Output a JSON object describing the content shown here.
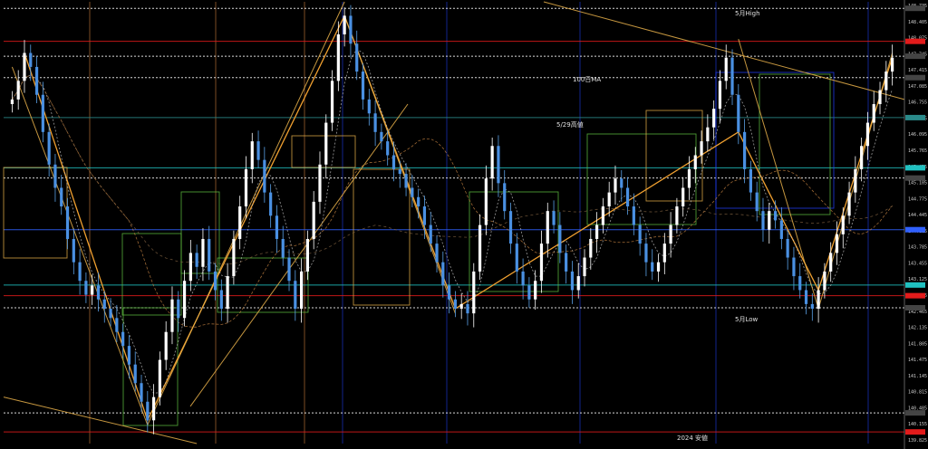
{
  "chart_data": {
    "type": "candlestick",
    "title": "",
    "xlabel": "",
    "ylabel": "",
    "ylim": [
      139.5,
      149.0
    ],
    "grid": false,
    "y_ticks": [
      "148.735",
      "148.405",
      "148.075",
      "147.745",
      "147.415",
      "147.085",
      "146.755",
      "146.425",
      "146.095",
      "145.765",
      "145.435",
      "145.105",
      "144.775",
      "144.445",
      "144.115",
      "143.785",
      "143.455",
      "143.125",
      "142.795",
      "142.465",
      "142.135",
      "141.805",
      "141.475",
      "141.145",
      "140.815",
      "140.485",
      "140.155",
      "139.825"
    ],
    "series": [
      {
        "values": [
          146.9,
          147.3,
          147.9,
          147.6,
          147.0,
          146.2,
          145.5,
          145.0,
          144.6,
          143.9,
          143.4,
          143.0,
          142.7,
          142.9,
          142.6,
          142.4,
          142.2,
          141.9,
          141.6,
          141.2,
          140.8,
          140.4,
          140.0,
          140.5,
          141.3,
          141.9,
          142.6,
          142.2,
          143.0,
          143.6,
          143.3,
          143.9,
          143.2,
          142.8,
          142.4,
          143.1,
          143.9,
          144.6,
          145.4,
          146.0,
          145.6,
          144.9,
          144.4,
          143.9,
          143.5,
          143.0,
          142.4,
          143.2,
          143.9,
          144.7,
          145.5,
          146.4,
          147.3,
          148.3,
          148.7,
          148.1,
          147.5,
          146.9,
          146.6,
          146.2,
          146.0,
          145.7,
          145.4,
          145.3,
          145.0,
          144.8,
          144.6,
          144.2,
          143.8,
          143.4,
          142.9,
          142.6,
          142.4,
          142.5,
          142.3,
          143.2,
          144.2,
          145.2,
          145.9,
          145.1,
          144.5,
          143.8,
          143.2,
          142.9,
          142.6,
          143.0,
          143.8,
          144.5,
          144.2,
          143.6,
          143.2,
          142.8,
          143.1,
          143.5,
          143.9,
          144.2,
          144.6,
          144.9,
          145.2,
          145.0,
          144.6,
          144.2,
          143.8,
          143.4,
          143.2,
          143.4,
          143.8,
          144.2,
          144.6,
          145.0,
          145.4,
          145.7,
          146.0,
          146.3,
          146.7,
          147.3,
          147.8,
          147.0,
          146.2,
          145.4,
          144.9,
          144.5,
          144.1,
          144.5,
          144.3,
          143.9,
          143.5,
          143.1,
          142.8,
          142.5,
          142.4,
          142.8,
          143.2,
          143.6,
          144.0,
          144.4,
          144.9,
          145.4,
          145.9,
          146.4,
          146.8,
          147.1,
          147.5,
          147.8
        ]
      }
    ],
    "horizontal_levels": [
      {
        "label": "5月High",
        "value": 148.86,
        "color": "#ffffff"
      },
      {
        "label": "",
        "value": 148.15,
        "color": "#e21b1b"
      },
      {
        "label": "",
        "value": 147.83,
        "color": "#ffffff"
      },
      {
        "label": "",
        "value": 147.37,
        "color": "#ffffff"
      },
      {
        "label": "5/29高値",
        "value": 146.51,
        "color": "#2a8a8a"
      },
      {
        "label": "",
        "value": 145.43,
        "color": "#20c0c0"
      },
      {
        "label": "",
        "value": 145.21,
        "color": "#ffffff"
      },
      {
        "label": "",
        "value": 144.1,
        "color": "#3060ff"
      },
      {
        "label": "",
        "value": 142.91,
        "color": "#20c0c0"
      },
      {
        "label": "",
        "value": 142.68,
        "color": "#e21b1b"
      },
      {
        "label": "5月Low",
        "value": 142.42,
        "color": "#ffffff"
      },
      {
        "label": "",
        "value": 140.16,
        "color": "#ffffff"
      },
      {
        "label": "2024 安値",
        "value": 139.75,
        "color": "#e21b1b"
      }
    ],
    "annotations": [
      "100日MA",
      "5月High",
      "5/29高値",
      "5月Low",
      "2024 安値"
    ]
  },
  "annotations_text": {
    "ma100": "100日MA",
    "may_high": "5月High",
    "may29_high": "5/29高値",
    "may_low": "5月Low",
    "year_low": "2024 安値"
  }
}
